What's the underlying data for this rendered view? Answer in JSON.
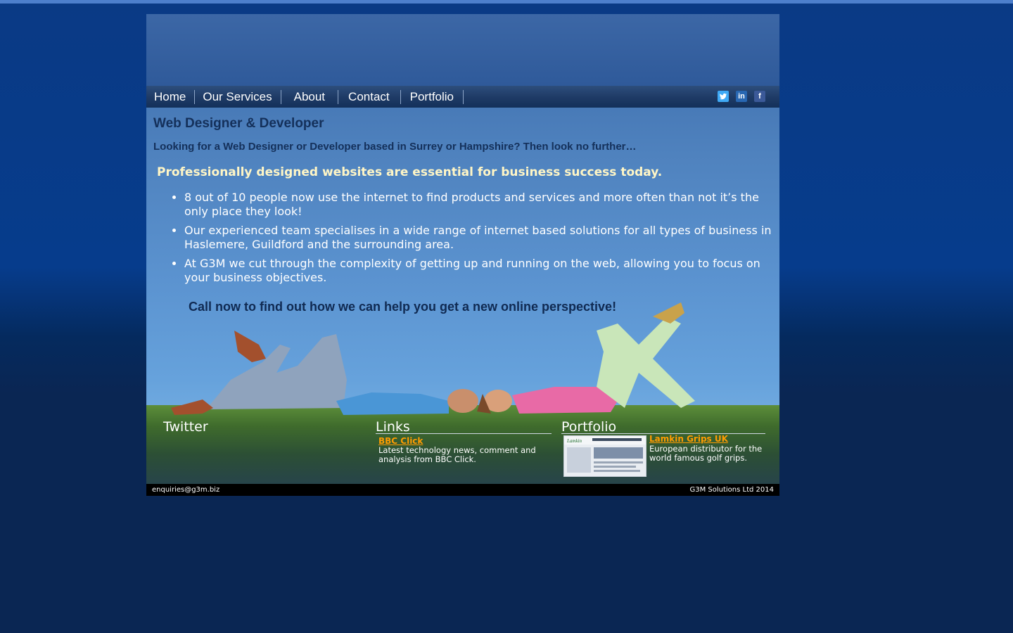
{
  "nav": {
    "items": [
      "Home",
      "Our Services",
      "About",
      "Contact",
      "Portfolio"
    ]
  },
  "social": {
    "twitter": "twitter-icon",
    "linkedin": "linkedin-icon",
    "facebook": "facebook-icon",
    "linkedin_glyph": "in",
    "facebook_glyph": "f"
  },
  "main": {
    "heading": "Web Designer & Developer",
    "intro": "Looking for a Web Designer or Developer based in Surrey or Hampshire? Then look no further…",
    "tagline": "Professionally designed websites are essential for business success today.",
    "bullets": [
      "8 out of 10 people now use the internet to find products and services and more often than not it’s the only place they look!",
      "Our experienced team specialises in a wide range of internet based solutions for all types of business in Haslemere, Guildford and the surrounding area.",
      "At G3M we cut through the complexity of getting up and running on the web, allowing you to focus on your business objectives."
    ],
    "call_to_action": "Call now to find out how we can help you get a new online perspective!"
  },
  "sections": {
    "twitter_title": "Twitter",
    "links_title": "Links",
    "portfolio_title": "Portfolio"
  },
  "links": {
    "title": "BBC Click",
    "description_line1": "Latest technology news, comment and",
    "description_line2": "analysis from BBC Click."
  },
  "portfolio": {
    "title": "Lamkin Grips UK",
    "description_line1": "European distributor for the",
    "description_line2": "world famous golf grips."
  },
  "footer": {
    "email": "enquiries@g3m.biz",
    "copyright": "G3M Solutions Ltd 2014"
  },
  "colors": {
    "nav_text": "#ffffff",
    "heading": "#14305a",
    "tagline": "#fff6c6",
    "link": "#ff9c00"
  }
}
